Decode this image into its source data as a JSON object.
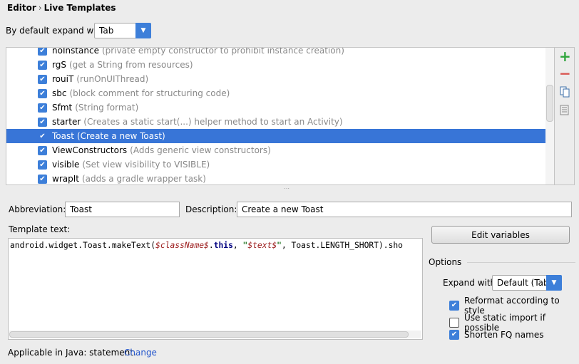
{
  "breadcrumb": {
    "parent": "Editor",
    "sep": "›",
    "current": "Live Templates"
  },
  "expand": {
    "label": "By default expand with",
    "value": "Tab"
  },
  "templates": [
    {
      "name": "noInstance",
      "desc": "(private empty constructor to prohibit instance creation)",
      "checked": true
    },
    {
      "name": "rgS",
      "desc": "(get a String from resources)",
      "checked": true
    },
    {
      "name": "rouiT",
      "desc": "(runOnUIThread)",
      "checked": true
    },
    {
      "name": "sbc",
      "desc": "(block comment for structuring code)",
      "checked": true
    },
    {
      "name": "Sfmt",
      "desc": "(String format)",
      "checked": true
    },
    {
      "name": "starter",
      "desc": "(Creates a static start(...) helper method to start an Activity)",
      "checked": true
    },
    {
      "name": "Toast",
      "desc": "(Create a new Toast)",
      "checked": true,
      "selected": true
    },
    {
      "name": "ViewConstructors",
      "desc": "(Adds generic view constructors)",
      "checked": true
    },
    {
      "name": "visible",
      "desc": "(Set view visibility to VISIBLE)",
      "checked": true
    },
    {
      "name": "wrapIt",
      "desc": "(adds a gradle wrapper task)",
      "checked": true
    }
  ],
  "toolbar": {
    "add": "+",
    "remove": "−"
  },
  "form": {
    "abbr_label": "Abbreviation:",
    "abbr_value": "Toast",
    "desc_label": "Description:",
    "desc_value": "Create a new Toast",
    "template_label": "Template text:"
  },
  "code": {
    "p1": "android.widget.Toast.makeText(",
    "v1": "$className$",
    "p2": ".",
    "kw": "this",
    "p3": ", ",
    "q1": "\"",
    "v2": "$text$",
    "q2": "\"",
    "p4": ", Toast.LENGTH_SHORT).sho"
  },
  "edit_vars": "Edit variables",
  "options": {
    "title": "Options",
    "expand_label": "Expand with",
    "expand_value": "Default (Tab)",
    "items": [
      {
        "label": "Reformat according to style",
        "checked": true
      },
      {
        "label": "Use static import if possible",
        "checked": false
      },
      {
        "label": "Shorten FQ names",
        "checked": true
      }
    ]
  },
  "footer": {
    "text": "Applicable in Java: statement.",
    "link": "Change"
  }
}
